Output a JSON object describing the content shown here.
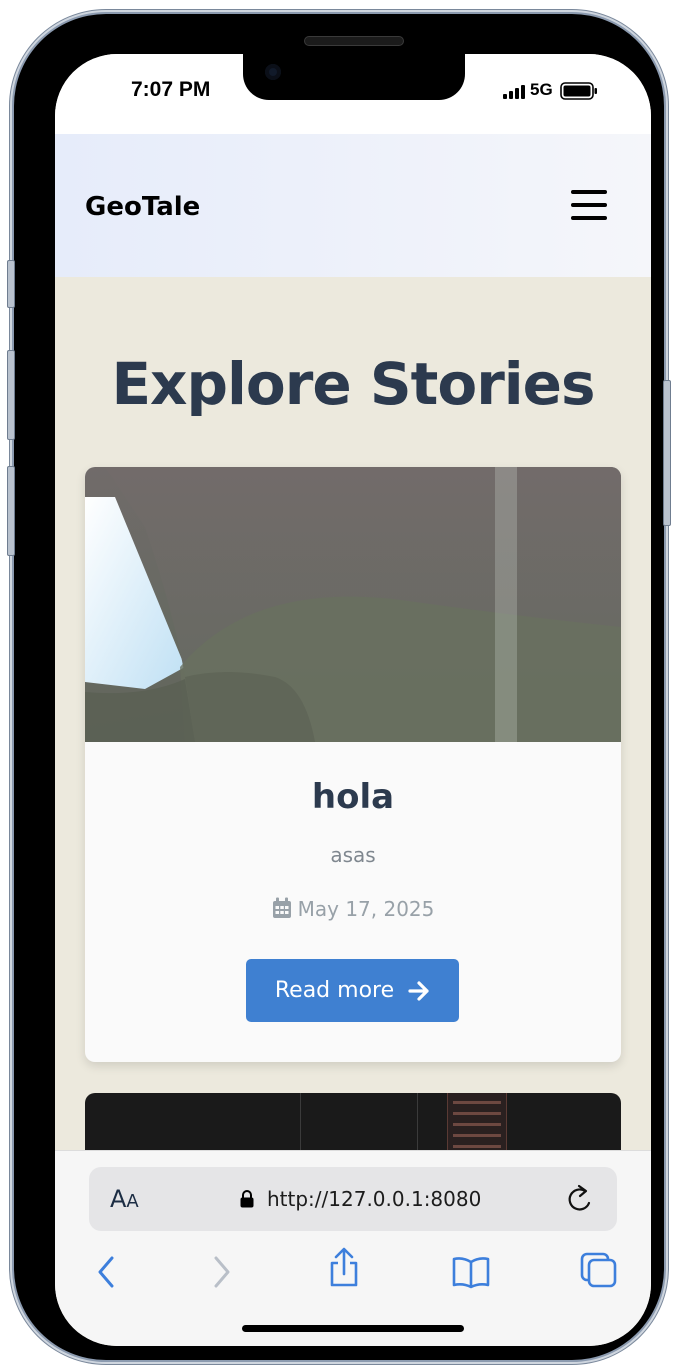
{
  "status_bar": {
    "time": "7:07 PM",
    "network": "5G",
    "icons": [
      "signal-bars-icon",
      "battery-icon"
    ]
  },
  "header": {
    "brand": "GeoTale",
    "menu_icon": "hamburger-menu-icon"
  },
  "main": {
    "title": "Explore Stories",
    "stories": [
      {
        "title": "hola",
        "excerpt": "asas",
        "date": "May 17, 2025",
        "date_icon": "calendar-icon",
        "button_label": "Read more",
        "button_icon": "arrow-right-icon"
      }
    ]
  },
  "browser": {
    "text_size_label": "AA",
    "url": "http://127.0.0.1:8080",
    "toolbar": [
      "back-icon",
      "forward-icon",
      "share-icon",
      "bookmarks-icon",
      "tabs-icon"
    ]
  },
  "colors": {
    "page_bg": "#ece9dd",
    "title": "#2c3a4e",
    "button": "#3f80d1",
    "ios_blue": "#3d7fdc"
  }
}
